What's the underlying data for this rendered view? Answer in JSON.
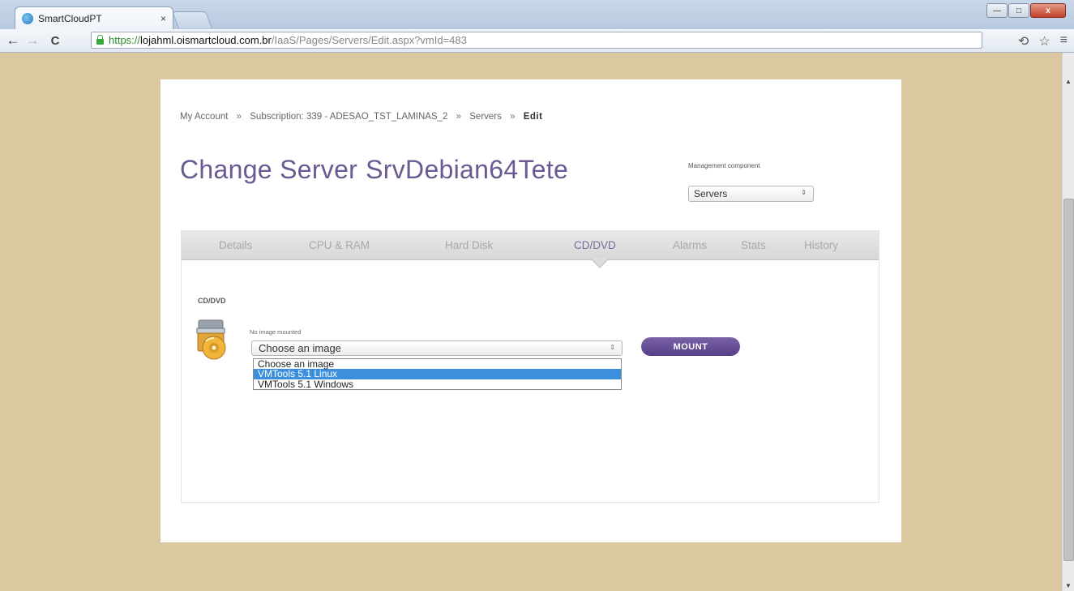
{
  "browser": {
    "tab_title": "SmartCloudPT",
    "tab_close": "×",
    "url_scheme": "https://",
    "url_host": "lojahml.oismartcloud.com.br",
    "url_path": "/IaaS/Pages/Servers/Edit.aspx?vmId=483",
    "back": "←",
    "forward": "→",
    "reload": "C",
    "translate_icon": "⟲",
    "star_icon": "☆",
    "menu_icon": "≡",
    "min": "—",
    "max": "□",
    "close": "x"
  },
  "breadcrumb": {
    "items": [
      "My Account",
      "Subscription: 339 - ADESAO_TST_LAMINAS_2",
      "Servers"
    ],
    "separator": "»",
    "current": "Edit"
  },
  "page": {
    "title_prefix": "Change Server",
    "server_name": "SrvDebian64Tete",
    "management_label": "Management component",
    "management_value": "Servers"
  },
  "tabs": [
    {
      "label": "Details"
    },
    {
      "label": "CPU & RAM"
    },
    {
      "label": "Hard Disk"
    },
    {
      "label": "CD/DVD",
      "active": true
    },
    {
      "label": "Alarms"
    },
    {
      "label": "Stats"
    },
    {
      "label": "History"
    }
  ],
  "cddvd": {
    "section_title": "CD/DVD",
    "status": "No image mounted",
    "select_value": "Choose an image",
    "options": [
      "Choose an image",
      "VMTools 5.1 Linux",
      "VMTools 5.1 Windows"
    ],
    "highlighted_option": "VMTools 5.1 Linux",
    "mount_label": "MOUNT"
  },
  "colors": {
    "accent": "#6b5a92",
    "button": "#5f4893",
    "selection": "#3b8fdc",
    "page_background": "#dcc8a0"
  }
}
